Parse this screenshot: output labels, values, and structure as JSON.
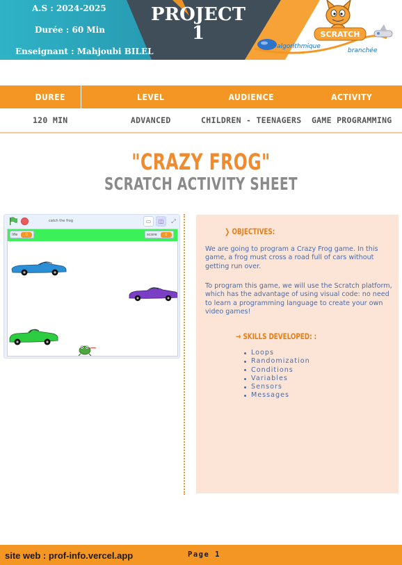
{
  "header": {
    "school_year": "A.S : 2024-2025",
    "duration": "Durée :  60 Min",
    "teacher": "Enseignant   : Mahjoubi BILEL",
    "project_line1": "PROJECT",
    "project_line2": "1",
    "logo": {
      "brand": "SCRATCH",
      "word1": "algorithmique",
      "word2": "branchée"
    },
    "colors": {
      "teal": "#2aa9bf",
      "dark": "#3f4e58",
      "orange": "#f39624"
    }
  },
  "info_table": {
    "headers": [
      "DUREE",
      "LEVEL",
      "AUDIENCE",
      "ACTIVITY"
    ],
    "values": [
      "120 MIN",
      "ADVANCED",
      "CHILDREN - TEENAGERS",
      "GAME PROGRAMMING"
    ]
  },
  "title": "\"CRAZY FROG\"",
  "subtitle": "SCRATCH ACTIVITY SHEET",
  "stage": {
    "project_name": "catch the frog",
    "monitors": [
      {
        "label": "life",
        "value": "0"
      },
      {
        "label": "score",
        "value": "0"
      }
    ],
    "sprites": [
      "blue-car",
      "purple-car",
      "green-car",
      "frog"
    ],
    "colors": {
      "bar": "#3cf05a",
      "blue_car": "#2a8fd6",
      "purple_car": "#7a3fc4",
      "green_car": "#2ecc40"
    }
  },
  "objectives": {
    "heading": "OBJECTIVES:",
    "paragraphs": [
      "We are going to program a Crazy Frog game. In this game, a frog must cross a road full of cars without getting run over.",
      "To program this game, we will use the Scratch platform, which has the advantage of using visual code: no need to learn a programming language to create your own video games!"
    ]
  },
  "skills": {
    "heading": "SKILLS DEVELOPED: :",
    "items": [
      "Loops",
      "Randomization",
      "Conditions",
      "Variables",
      "Sensors",
      "Messages"
    ]
  },
  "footer": {
    "site": "site web : prof-info.vercel.app",
    "page": "Page 1"
  }
}
